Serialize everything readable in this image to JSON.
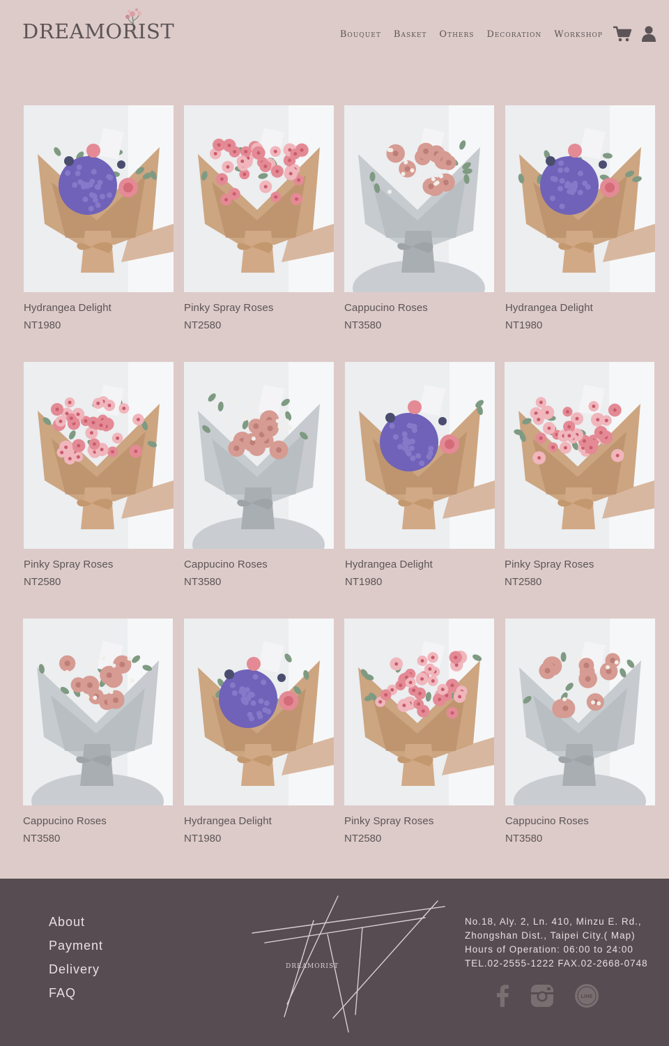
{
  "brand": {
    "name": "DREAMORIST",
    "footer_mark": "DREAMORIST"
  },
  "nav": {
    "items": [
      "Bouquet",
      "Basket",
      "Others",
      "Decoration",
      "Workshop"
    ]
  },
  "colors": {
    "background": "#ddcbc9",
    "footer": "#564c51",
    "text": "#5c5456",
    "hydrangea": "#6f62b8",
    "rose_pink": "#e48a95",
    "cappucino": "#d69b92",
    "kraft": "#caa07a"
  },
  "products": [
    {
      "name": "Hydrangea Delight",
      "price": "NT1980",
      "style": "hydrangea"
    },
    {
      "name": "Pinky Spray Roses",
      "price": "NT2580",
      "style": "spray"
    },
    {
      "name": "Cappucino Roses",
      "price": "NT3580",
      "style": "cappucino"
    },
    {
      "name": "Hydrangea Delight",
      "price": "NT1980",
      "style": "hydrangea"
    },
    {
      "name": "Pinky Spray Roses",
      "price": "NT2580",
      "style": "spray"
    },
    {
      "name": "Cappucino Roses",
      "price": "NT3580",
      "style": "cappucino"
    },
    {
      "name": "Hydrangea Delight",
      "price": "NT1980",
      "style": "hydrangea"
    },
    {
      "name": "Pinky Spray Roses",
      "price": "NT2580",
      "style": "spray"
    },
    {
      "name": "Cappucino Roses",
      "price": "NT3580",
      "style": "cappucino"
    },
    {
      "name": "Hydrangea Delight",
      "price": "NT1980",
      "style": "hydrangea"
    },
    {
      "name": "Pinky Spray Roses",
      "price": "NT2580",
      "style": "spray"
    },
    {
      "name": "Cappucino Roses",
      "price": "NT3580",
      "style": "cappucino"
    }
  ],
  "footer": {
    "links": [
      "About",
      "Payment",
      "Delivery",
      "FAQ"
    ],
    "address_line1": "No.18, Aly. 2, Ln. 410, Minzu E. Rd.,",
    "address_line2_prefix": "Zhongshan Dist., Taipei City.( ",
    "map_label": "Map",
    "address_line2_suffix": ")",
    "hours": "Hours of Operation: 06:00 to 24:00",
    "phone": "TEL.02-2555-1222 FAX.02-2668-0748",
    "line_label": "LINE",
    "social": [
      "facebook-icon",
      "instagram-icon",
      "line-icon"
    ]
  }
}
